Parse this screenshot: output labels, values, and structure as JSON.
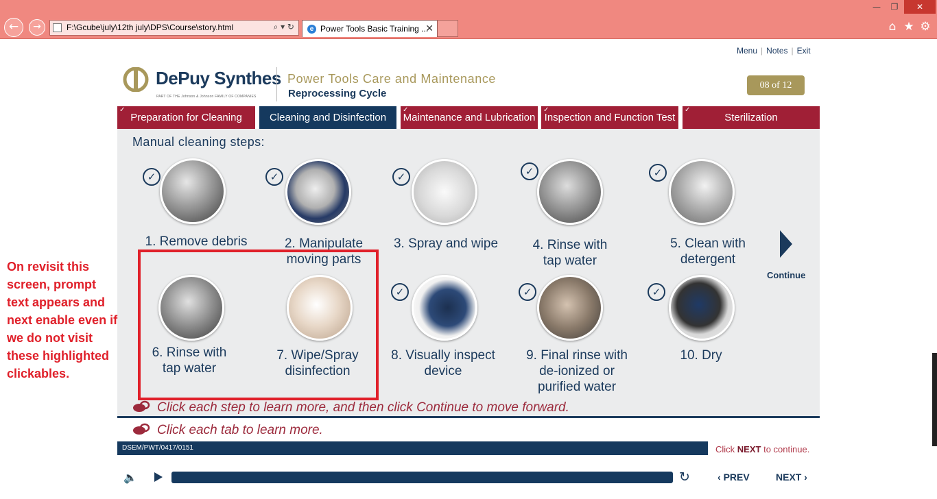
{
  "browser": {
    "address": "F:\\Gcube\\july\\12th july\\DPS\\Course\\story.html",
    "tab_title": "Power Tools Basic Training ...",
    "tab_close": "✕",
    "window_min": "—",
    "window_max": "❐",
    "window_close": "✕",
    "icons": [
      "back-icon",
      "forward-icon",
      "home-icon",
      "star-icon",
      "gear-icon"
    ]
  },
  "top_links": {
    "menu": "Menu",
    "notes": "Notes",
    "exit": "Exit"
  },
  "header": {
    "brand": "DePuy Synthes",
    "brand_sub": "PART OF THE Johnson & Johnson FAMILY OF COMPANIES",
    "title": "Power Tools Care and Maintenance",
    "subtitle": "Reprocessing Cycle",
    "page": "08 of 12"
  },
  "tabs": [
    {
      "label": "Preparation for Cleaning",
      "checked": true,
      "active": false
    },
    {
      "label": "Cleaning and Disinfection",
      "checked": false,
      "active": true
    },
    {
      "label": "Maintenance and Lubrication",
      "checked": true,
      "active": false
    },
    {
      "label": "Inspection and Function Test",
      "checked": true,
      "active": false
    },
    {
      "label": "Sterilization",
      "checked": true,
      "active": false
    }
  ],
  "main": {
    "heading": "Manual cleaning steps:",
    "steps": [
      {
        "label": "1. Remove debris",
        "checked": true
      },
      {
        "label": "2. Manipulate\nmoving parts",
        "checked": true
      },
      {
        "label": "3. Spray and wipe",
        "checked": true
      },
      {
        "label": "4. Rinse with\ntap water",
        "checked": true
      },
      {
        "label": "5. Clean with\ndetergent",
        "checked": true
      },
      {
        "label": "6. Rinse with\ntap water",
        "checked": false
      },
      {
        "label": "7. Wipe/Spray\ndisinfection",
        "checked": false
      },
      {
        "label": "8. Visually inspect\ndevice",
        "checked": true
      },
      {
        "label": "9. Final rinse with\nde-ionized or\npurified water",
        "checked": true
      },
      {
        "label": "10. Dry",
        "checked": true
      }
    ],
    "continue_label": "Continue",
    "prompt_steps": "Click each step to learn more, and then click Continue to move forward.",
    "prompt_tabs": "Click each tab to learn more."
  },
  "annotation": "On revisit this screen, prompt text appears and next enable even if we do not visit these highlighted clickables.",
  "footer": {
    "code": "DSEM/PWT/0417/0151",
    "click_prefix": "Click",
    "click_next": "NEXT",
    "click_suffix": "to continue.",
    "prev": "PREV",
    "next": "NEXT"
  },
  "colors": {
    "brand_navy": "#1b3a5c",
    "tab_red": "#a01f36",
    "gold": "#a8985b",
    "highlight_red": "#e0202a"
  }
}
